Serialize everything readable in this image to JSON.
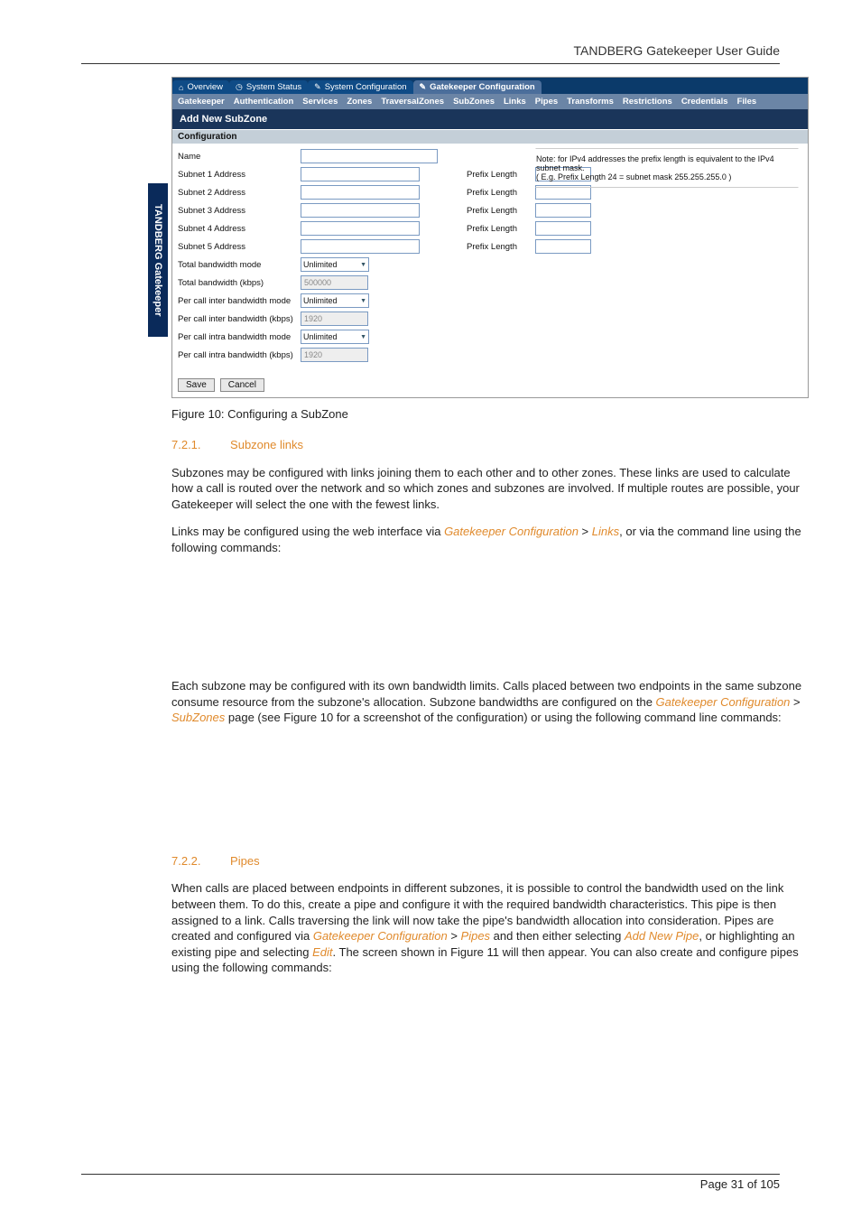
{
  "doc_title": "TANDBERG Gatekeeper User Guide",
  "pager": "Page 31 of 105",
  "sidebar_brand": "TANDBERG Gatekeeper",
  "screenshot": {
    "tabs": [
      "Overview",
      "System Status",
      "System Configuration",
      "Gatekeeper Configuration"
    ],
    "subtabs": [
      "Gatekeeper",
      "Authentication",
      "Services",
      "Zones",
      "TraversalZones",
      "SubZones",
      "Links",
      "Pipes",
      "Transforms",
      "Restrictions",
      "Credentials",
      "Files"
    ],
    "window_title": "Add New SubZone",
    "panel_head": "Configuration",
    "rows": {
      "name": "Name",
      "subnet": [
        "Subnet 1 Address",
        "Subnet 2 Address",
        "Subnet 3 Address",
        "Subnet 4 Address",
        "Subnet 5 Address"
      ],
      "prefix_label": "Prefix Length",
      "total_bw_mode": "Total bandwidth mode",
      "total_bw_kbps": "Total bandwidth (kbps)",
      "per_inter_mode": "Per call inter bandwidth mode",
      "per_inter_kbps": "Per call inter bandwidth (kbps)",
      "per_intra_mode": "Per call intra bandwidth mode",
      "per_intra_kbps": "Per call intra bandwidth (kbps)"
    },
    "values": {
      "mode_option": "Unlimited",
      "total_bw_kbps": "500000",
      "per_inter_kbps": "1920",
      "per_intra_kbps": "1920"
    },
    "note": "Note: for IPv4 addresses the prefix length is equivalent to the IPv4 subnet mask.\n( E.g. Prefix Length 24 = subnet mask 255.255.255.0 )",
    "save": "Save",
    "cancel": "Cancel"
  },
  "fig_caption": "Figure 10: Configuring a SubZone",
  "sec_721_num": "7.2.1.",
  "sec_721_title": "Subzone links",
  "p721a": "Subzones may be configured with links joining them to each other and to other zones. These links are used to calculate how a call is routed over the network and so which zones and subzones are involved. If multiple routes are possible, your Gatekeeper will select the one with the fewest links.",
  "p721b_pre": "Links may be configured using the web interface via ",
  "p721b_link1": "Gatekeeper Configuration",
  "p721b_gt": " > ",
  "p721b_link2": "Links",
  "p721b_post": ", or via the command line using the following commands:",
  "p721c_pre": "Each subzone may be configured with its own bandwidth limits. Calls placed between two endpoints in the same subzone consume resource from the subzone's allocation. Subzone bandwidths are configured on the ",
  "p721c_link1": "Gatekeeper Configuration",
  "p721c_gt": " > ",
  "p721c_link2": "SubZones",
  "p721c_post": " page (see Figure 10 for a screenshot of the configuration) or using the following command line commands:",
  "sec_722_num": "7.2.2.",
  "sec_722_title": "Pipes",
  "p722_pre": "When calls are placed between endpoints in different subzones, it is possible to control the bandwidth used on the link between them. To do this, create a pipe and configure it with the required bandwidth characteristics. This pipe is then assigned to a link. Calls traversing the link will now take the pipe's bandwidth allocation into consideration. Pipes are created and configured via ",
  "p722_link1": "Gatekeeper Configuration",
  "p722_gt1": " > ",
  "p722_link2": "Pipes",
  "p722_mid1": " and then either selecting ",
  "p722_link3": "Add New Pipe",
  "p722_mid2": ", or highlighting an existing pipe and selecting ",
  "p722_link4": "Edit",
  "p722_post": ".  The screen shown in Figure 11 will then appear.  You can also create and configure pipes using the following commands:"
}
